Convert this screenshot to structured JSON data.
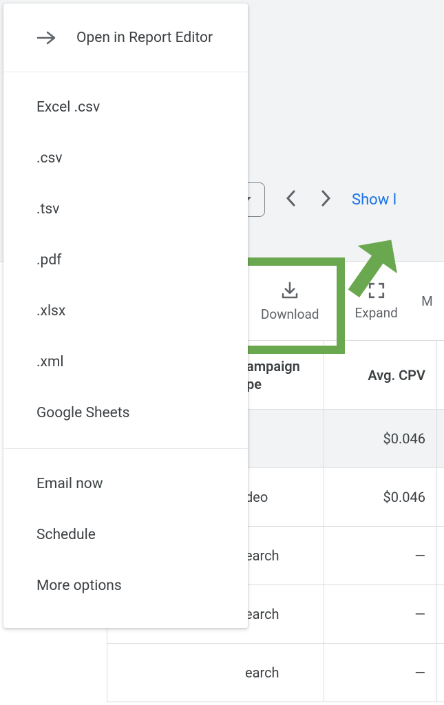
{
  "menu": {
    "open_in_editor": "Open in Report Editor",
    "formats": [
      "Excel .csv",
      ".csv",
      ".tsv",
      ".pdf",
      ".xlsx",
      ".xml",
      "Google Sheets"
    ],
    "actions": [
      "Email now",
      "Schedule",
      "More options"
    ]
  },
  "toolbar": {
    "show_link": "Show l",
    "download_label": "Download",
    "expand_label": "Expand",
    "more_label": "M"
  },
  "table": {
    "headers": {
      "campaign_type": "ampaign pe",
      "avg_cpv": "Avg. CPV"
    },
    "rows": [
      {
        "type": "",
        "cpv": "$0.046",
        "total": true
      },
      {
        "type": "deo",
        "cpv": "$0.046",
        "total": false
      },
      {
        "type": "earch",
        "cpv": "—",
        "total": false
      },
      {
        "type": "earch",
        "cpv": "—",
        "total": false
      },
      {
        "type": "earch",
        "cpv": "—",
        "total": false
      }
    ]
  }
}
